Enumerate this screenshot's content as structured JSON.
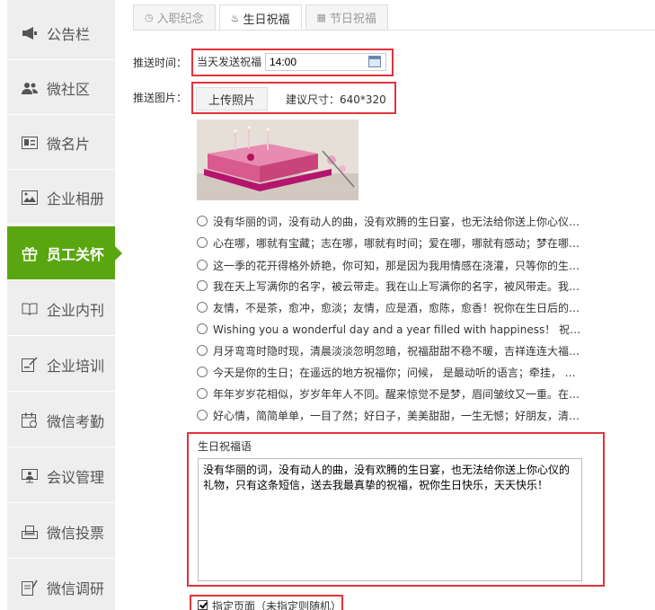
{
  "sidebar": {
    "items": [
      {
        "label": "公告栏",
        "icon": "megaphone-icon"
      },
      {
        "label": "微社区",
        "icon": "users-icon"
      },
      {
        "label": "微名片",
        "icon": "id-card-icon"
      },
      {
        "label": "企业相册",
        "icon": "image-icon"
      },
      {
        "label": "员工关怀",
        "icon": "gift-icon",
        "active": true
      },
      {
        "label": "企业内刊",
        "icon": "book-icon"
      },
      {
        "label": "企业培训",
        "icon": "training-icon"
      },
      {
        "label": "微信考勤",
        "icon": "calendar-check-icon"
      },
      {
        "label": "会议管理",
        "icon": "meeting-icon"
      },
      {
        "label": "微信投票",
        "icon": "vote-icon"
      },
      {
        "label": "微信调研",
        "icon": "survey-icon"
      }
    ],
    "active_color": "#5aa610"
  },
  "tabs": [
    {
      "label": "入职纪念",
      "icon": "clock-icon"
    },
    {
      "label": "生日祝福",
      "icon": "cake-icon",
      "active": true
    },
    {
      "label": "节日祝福",
      "icon": "calendar-icon"
    }
  ],
  "form": {
    "push_time_label": "推送时间：",
    "push_time_prefix": "当天发送祝福",
    "push_time_value": "14:00",
    "push_image_label": "推送图片：",
    "upload_label": "上传照片",
    "size_hint": "建议尺寸：640*320"
  },
  "blessings": [
    "没有华丽的词，没有动人的曲，没有欢腾的生日宴，也无法给你送上你心仪的礼物，只有这条短信，送去我最真挚的祝福，祝你生日快乐，天天快乐！",
    "心在哪，哪就有宝藏；志在哪，哪就有时间；爱在哪，哪就有感动；梦在哪，哪就有未来；你在哪，哪就有我的祝福，生日快乐！",
    "这一季的花开得格外娇艳，你可知，那是因为我用情感在浇灌，只等你的生日到来，我把这份美丽与祝福一起送给你！",
    "我在天上写满你的名字，被云带走。我在山上写满你的名字，被风带走。我在心里写满你的名字，祝你生日快乐！",
    "友情，不是茶，愈冲，愈淡；友情，应是酒，愈陈，愈香！祝你在生日后的每一天都快乐幸福！",
    "Wishing you a wonderful day and a year filled with happiness！ 祝你生日快乐！",
    "月牙弯弯时隐时现，清晨淡淡忽明忽暗，祝福甜甜不稳不暖，吉祥连连大福大满，生日快乐！",
    "今天是你的生日；在遥远的地方祝福你；问候， 是最动听的语言；牵挂， 是最温暖的心情！",
    "年年岁岁花相似，岁岁年年人不同。醒来惊觉不是梦，眉间皱纹又一重。在你生日的这一天，祝你快乐！",
    "好心情，简简单单，一目了然；好日子，美美甜甜，一生无憾；好朋友，清清爽爽，一世相伴，生日快乐！"
  ],
  "bless_label": "生日祝福语",
  "bless_text": "没有华丽的词，没有动人的曲，没有欢腾的生日宴，也无法给你送上你心仪的礼物，只有这条短信，送去我最真挚的祝福，祝你生日快乐，天天快乐！",
  "specify_page_label": "指定页面（未指定则随机）",
  "highlight_color": "#e0343a"
}
